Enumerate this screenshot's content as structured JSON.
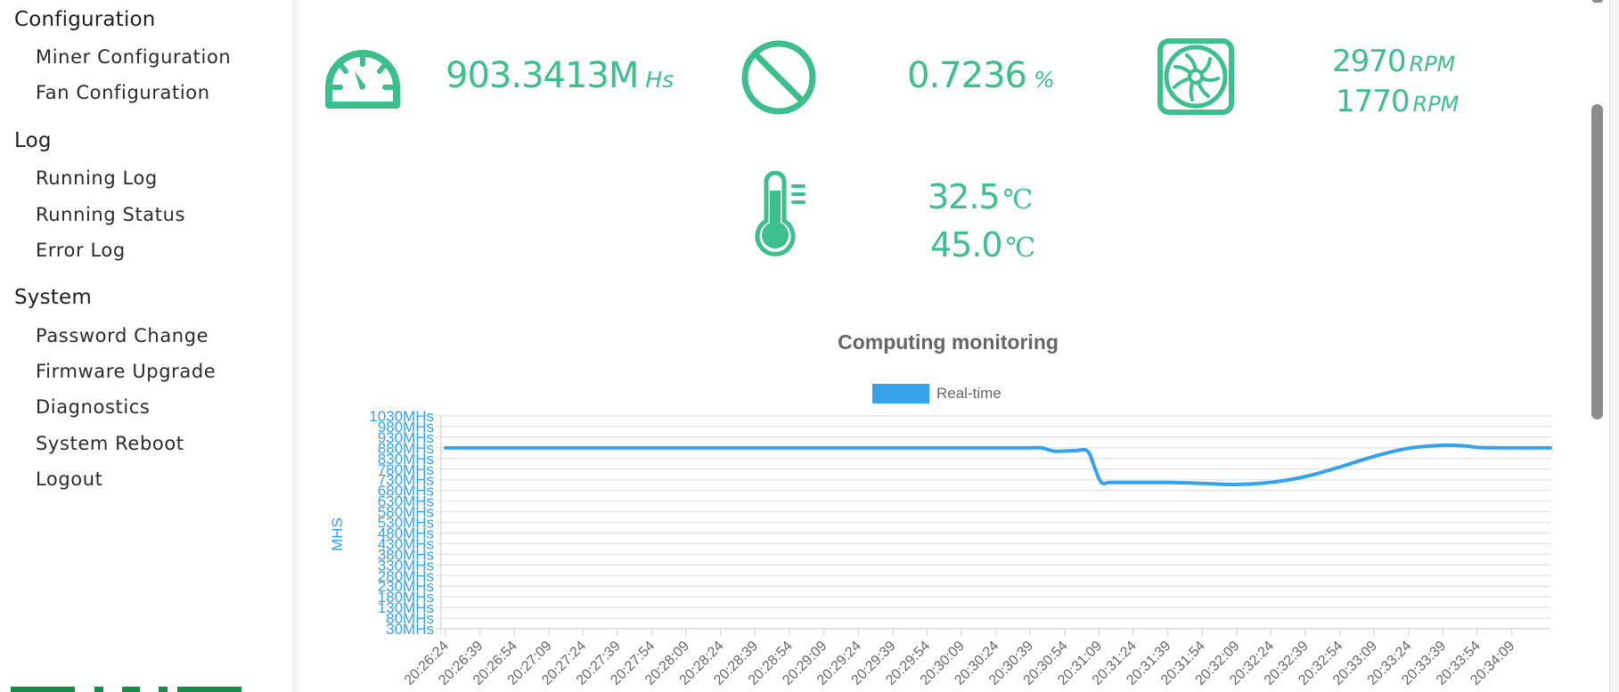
{
  "sidebar": {
    "groups": [
      {
        "title": "Configuration",
        "items": [
          "Miner Configuration",
          "Fan Configuration"
        ]
      },
      {
        "title": "Log",
        "items": [
          "Running Log",
          "Running Status",
          "Error Log"
        ]
      },
      {
        "title": "System",
        "items": [
          "Password Change",
          "Firmware Upgrade",
          "Diagnostics",
          "System Reboot",
          "Logout"
        ]
      }
    ]
  },
  "stats": {
    "hashrate": {
      "icon": "speedometer-icon",
      "value": "903.3413M",
      "unit": "Hs"
    },
    "reject": {
      "icon": "prohibited-icon",
      "value": "0.7236",
      "unit": "%"
    },
    "fans": {
      "icon": "fan-icon",
      "values": [
        "2970",
        "1770"
      ],
      "unit": "RPM"
    },
    "temperature": {
      "icon": "thermometer-icon",
      "values": [
        "32.5",
        "45.0"
      ],
      "unit": "℃"
    }
  },
  "colors": {
    "accent": "#3cbf8c",
    "series": "#36a2eb",
    "grid": "#e6e6e6",
    "scrollbar": "#8c8c8c",
    "logo": "#1a8a4a"
  },
  "chart_data": {
    "type": "line",
    "title": "Computing monitoring",
    "xlabel": "",
    "ylabel": "MHS",
    "legend": {
      "position": "top",
      "entries": [
        "Real-time"
      ]
    },
    "grid": true,
    "ylim": [
      30,
      1030
    ],
    "y_ticks": [
      "1030MHs",
      "980MHs",
      "930MHs",
      "880MHs",
      "830MHs",
      "780MHs",
      "730MHs",
      "680MHs",
      "630MHs",
      "580MHs",
      "530MHs",
      "480MHs",
      "430MHs",
      "380MHs",
      "330MHs",
      "280MHs",
      "230MHs",
      "180MHs",
      "130MHs",
      "80MHs",
      "30MHs"
    ],
    "x_ticks": [
      "20:26:24",
      "20:26:39",
      "20:26:54",
      "20:27:09",
      "20:27:24",
      "20:27:39",
      "20:27:54",
      "20:28:09",
      "20:28:24",
      "20:28:39",
      "20:28:54",
      "20:29:09",
      "20:29:24",
      "20:29:39",
      "20:29:54",
      "20:30:09",
      "20:30:24",
      "20:30:39",
      "20:30:54",
      "20:31:09",
      "20:31:24",
      "20:31:39",
      "20:31:54",
      "20:32:09",
      "20:32:24",
      "20:32:39",
      "20:32:54",
      "20:33:09",
      "20:33:24",
      "20:33:39",
      "20:33:54",
      "20:34:09"
    ],
    "series": [
      {
        "name": "Real-time",
        "x_seconds": [
          0,
          60,
          120,
          180,
          240,
          255,
          260,
          265,
          270,
          275,
          280,
          283,
          286,
          290,
          300,
          315,
          330,
          345,
          360,
          375,
          390,
          405,
          420,
          435,
          445,
          450,
          460,
          470
        ],
        "values": [
          880,
          880,
          880,
          880,
          880,
          880,
          880,
          865,
          865,
          867,
          865,
          790,
          718,
          717,
          717,
          717,
          713,
          708,
          718,
          745,
          790,
          840,
          878,
          892,
          889,
          882,
          880,
          880
        ]
      }
    ]
  }
}
